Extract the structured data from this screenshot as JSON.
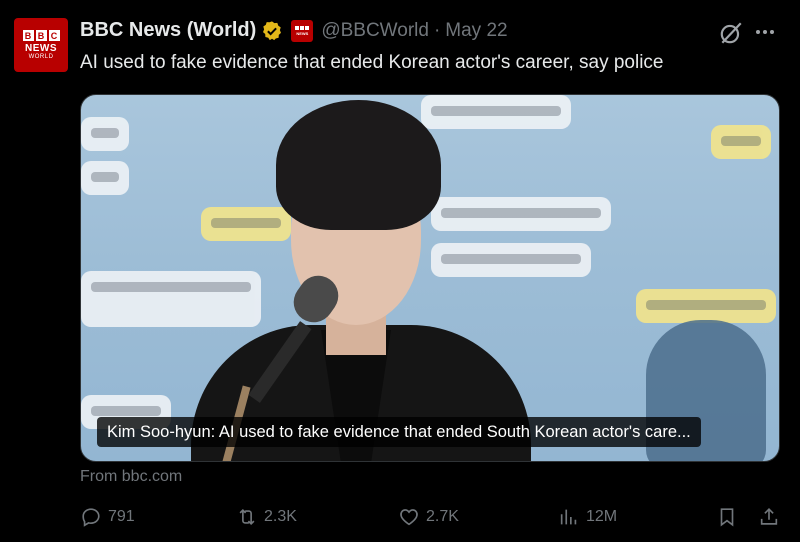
{
  "author": {
    "display_name": "BBC News (World)",
    "handle": "@BBCWorld",
    "separator": "·",
    "date": "May 22",
    "avatar_lines": [
      "B",
      "B",
      "C",
      "NEWS",
      "WORLD"
    ]
  },
  "tweet": {
    "text": "AI used to fake evidence that ended Korean actor's career, say police"
  },
  "media": {
    "caption": "Kim Soo-hyun: AI used to fake evidence that ended South Korean actor's care..."
  },
  "link_source": "From bbc.com",
  "actions": {
    "replies": "791",
    "reposts": "2.3K",
    "likes": "2.7K",
    "views": "12M"
  },
  "icons": {
    "verified": "verified-badge-icon",
    "grok": "grok-icon",
    "more": "more-icon",
    "reply": "reply-icon",
    "repost": "repost-icon",
    "like": "heart-icon",
    "views": "views-icon",
    "bookmark": "bookmark-icon",
    "share": "share-icon"
  },
  "colors": {
    "background": "#000000",
    "text": "#e7e9ea",
    "muted": "#71767b",
    "verified": "#e2b719",
    "bbc_red": "#b80000"
  }
}
